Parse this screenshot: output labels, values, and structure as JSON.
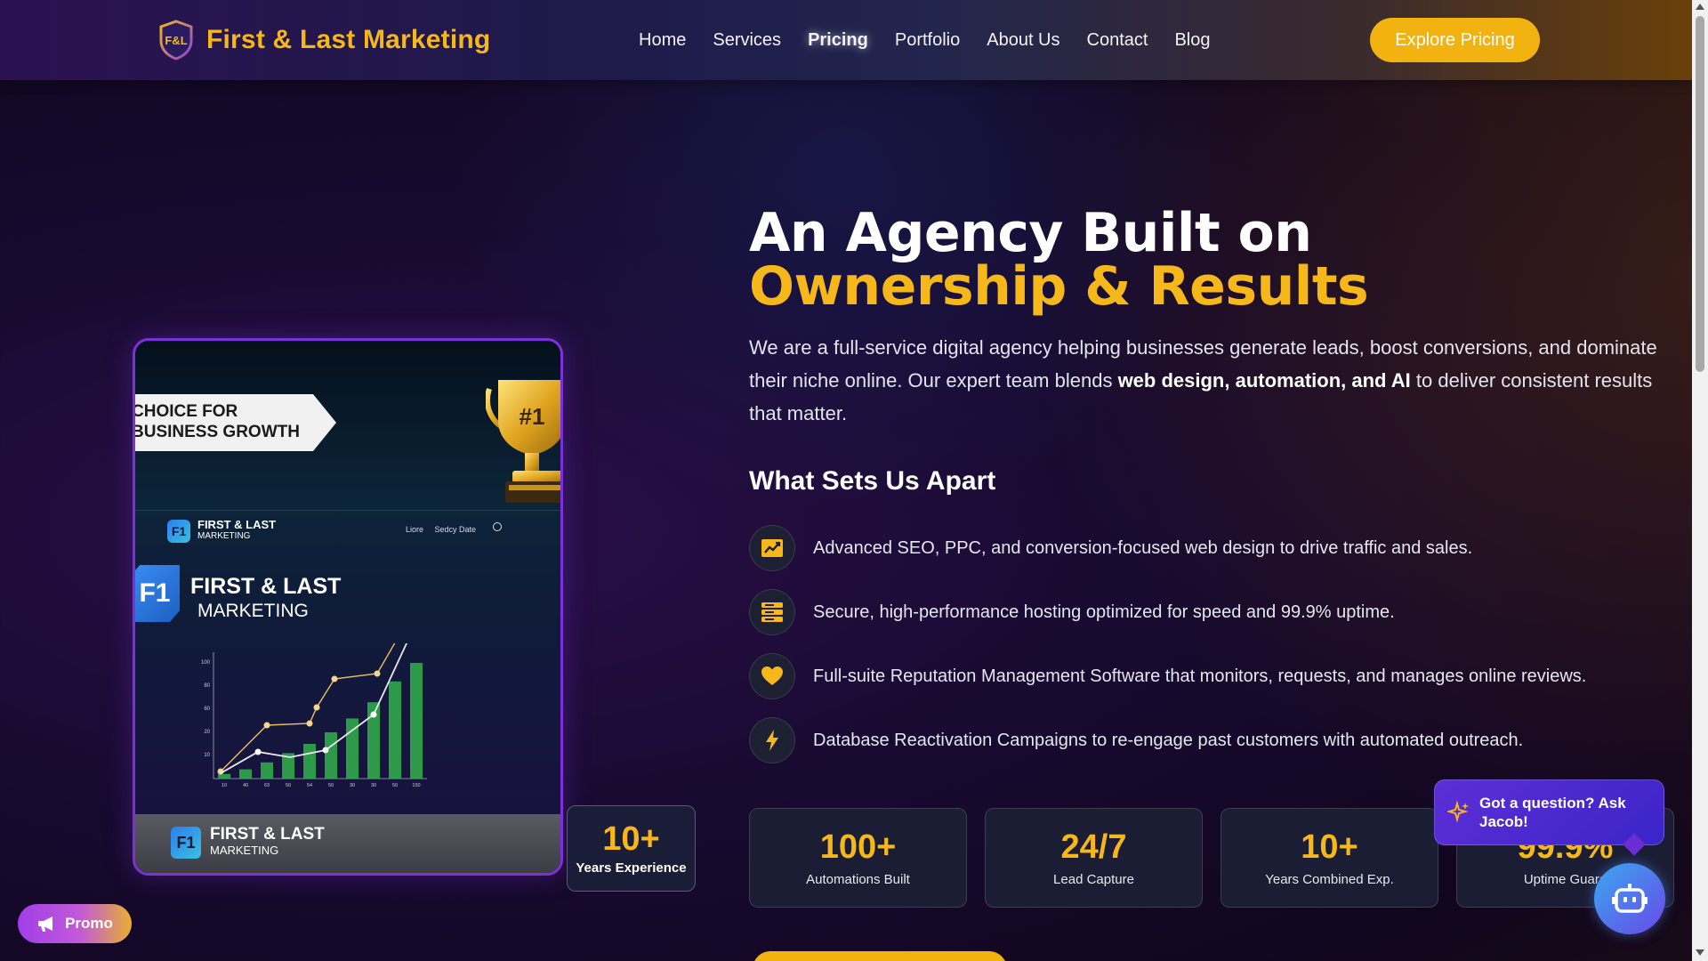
{
  "header": {
    "brand_name": "First & Last Marketing",
    "logo_text": "F&L",
    "nav": [
      {
        "label": "Home"
      },
      {
        "label": "Services"
      },
      {
        "label": "Pricing",
        "active": true
      },
      {
        "label": "Portfolio"
      },
      {
        "label": "About Us"
      },
      {
        "label": "Contact"
      },
      {
        "label": "Blog"
      }
    ],
    "cta_label": "Explore Pricing"
  },
  "hero_image": {
    "ribbon_line1": "CHOICE FOR",
    "ribbon_line2": "BUSINESS GROWTH",
    "trophy_text": "#1",
    "mini_logo": "F1",
    "mini_brand": "FIRST & LAST",
    "mini_brand_sub": "MARKETING",
    "mini_nav": "Liore     Sedcy Date",
    "big_logo": "F1",
    "big_brand": "FIRST & LAST",
    "big_brand_sub": "MARKETING",
    "chart_y_ticks": [
      "100",
      "80",
      "60",
      "20",
      "10"
    ],
    "chart_x_ticks": [
      "10",
      "40",
      "63",
      "50",
      "54",
      "50",
      "30",
      "30",
      "50",
      "150"
    ],
    "footer_logo": "F1",
    "footer_brand": "FIRST & LAST",
    "footer_brand_sub": "MARKETING"
  },
  "experience_badge": {
    "value": "10+",
    "label": "Years Experience"
  },
  "hero": {
    "title_line1": "An Agency Built on",
    "title_line2": "Ownership & Results",
    "desc_part1": "We are a full-service digital agency helping businesses generate leads, boost conversions, and dominate their niche online. Our expert team blends ",
    "desc_bold": "web design, automation, and AI",
    "desc_part2": " to deliver consistent results that matter."
  },
  "apart": {
    "title": "What Sets Us Apart",
    "features": [
      {
        "icon": "chart-line-icon",
        "text": "Advanced SEO, PPC, and conversion-focused web design to drive traffic and sales."
      },
      {
        "icon": "server-icon",
        "text": "Secure, high-performance hosting optimized for speed and 99.9% uptime."
      },
      {
        "icon": "heart-icon",
        "text": "Full-suite Reputation Management Software that monitors, requests, and manages online reviews."
      },
      {
        "icon": "bolt-icon",
        "text": "Database Reactivation Campaigns to re-engage past customers with automated outreach."
      }
    ]
  },
  "stats": [
    {
      "value": "100+",
      "label": "Automations Built"
    },
    {
      "value": "24/7",
      "label": "Lead Capture"
    },
    {
      "value": "10+",
      "label": "Years Combined Exp."
    },
    {
      "value": "99.9%",
      "label": "Uptime Guara"
    }
  ],
  "chat": {
    "bubble_text": "Got a question? Ask Jacob!"
  },
  "promo": {
    "label": "Promo"
  },
  "colors": {
    "accent": "#f5b71a",
    "purple": "#7a32d6"
  }
}
